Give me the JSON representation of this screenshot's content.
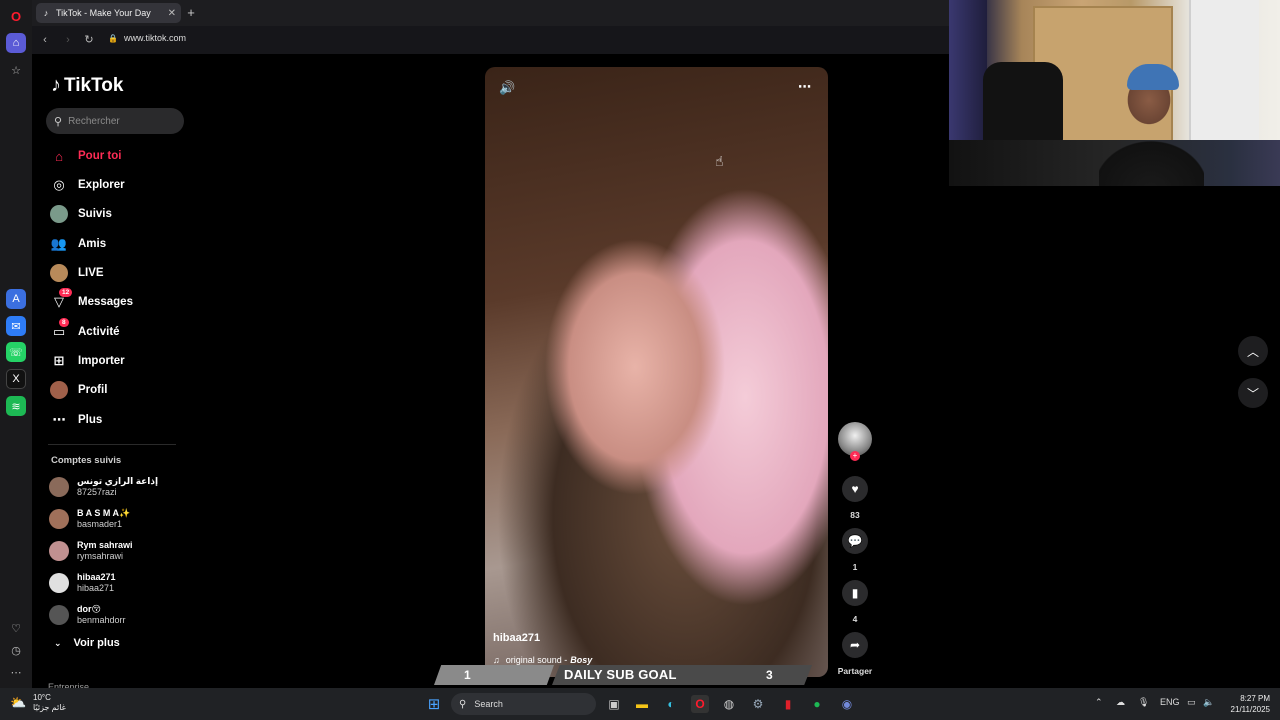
{
  "browser": {
    "tab_title": "TikTok - Make Your Day",
    "tab_close": "✕",
    "new_tab": "+",
    "url": "www.tiktok.com"
  },
  "tiktok": {
    "logo_text": "TikTok",
    "search_placeholder": "Rechercher",
    "menu": [
      {
        "label": "Pour toi",
        "icon": "home-icon"
      },
      {
        "label": "Explorer",
        "icon": "compass-icon"
      },
      {
        "label": "Suivis",
        "icon": "following-avatar-icon"
      },
      {
        "label": "Amis",
        "icon": "friends-icon"
      },
      {
        "label": "LIVE",
        "icon": "live-icon"
      },
      {
        "label": "Messages",
        "icon": "messages-icon",
        "badge": "12"
      },
      {
        "label": "Activité",
        "icon": "activity-icon",
        "badge": "8"
      },
      {
        "label": "Importer",
        "icon": "upload-icon"
      },
      {
        "label": "Profil",
        "icon": "profile-icon"
      },
      {
        "label": "Plus",
        "icon": "more-icon"
      }
    ],
    "following_title": "Comptes suivis",
    "following": [
      {
        "name": "إذاعة الرازي تونس",
        "handle": "87257razi"
      },
      {
        "name": "B A S M A✨",
        "handle": "basmader1"
      },
      {
        "name": "Rym sahrawi",
        "handle": "rymsahrawi"
      },
      {
        "name": "hibaa271",
        "handle": "hibaa271"
      },
      {
        "name": "dor😚",
        "handle": "benmahdorr"
      }
    ],
    "see_more": "Voir plus",
    "cutoff_text": "Entreprise"
  },
  "video": {
    "username": "hibaa271",
    "sound_prefix": "original sound -",
    "sound_author": "Bosy",
    "likes": "83",
    "comments": "1",
    "saves": "4",
    "share_label": "Partager"
  },
  "stream_overlay": {
    "goal_current": "1",
    "goal_label": "DAILY SUB GOAL",
    "goal_target": "3"
  },
  "taskbar": {
    "temperature": "10°C",
    "weather_text": "غائم جزئيًا",
    "search_label": "Search",
    "language": "ENG",
    "time": "8:27 PM",
    "date": "21/11/2025"
  }
}
